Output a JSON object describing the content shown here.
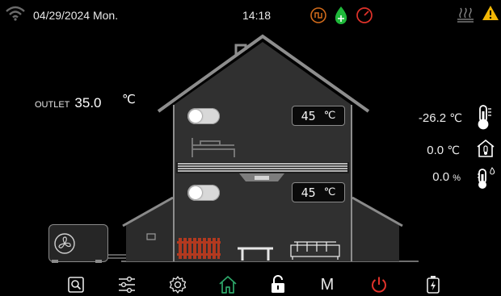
{
  "status_bar": {
    "wifi_icon": "wifi-icon",
    "datetime": "04/29/2024 Mon.",
    "time": "14:18",
    "center_icons": [
      "pump-icon",
      "add-drop-icon",
      "gauge-icon"
    ],
    "right_icons": [
      "floor-heating-icon",
      "warning-icon"
    ]
  },
  "colors": {
    "background": "#000000",
    "house_fill": "#2f2f2f",
    "accent_orange": "#d06a1a",
    "accent_green": "#1fb83a",
    "accent_red": "#e0322a",
    "warning_yellow": "#f2b705",
    "home_active": "#2ea86a",
    "power_red": "#e0322a"
  },
  "outlet": {
    "label": "OUTLET",
    "value": "35.0",
    "unit": "℃"
  },
  "zones": [
    {
      "name": "upper",
      "setpoint": "45",
      "unit": "℃",
      "toggle_on": false
    },
    {
      "name": "lower",
      "setpoint": "45",
      "unit": "℃",
      "toggle_on": false
    }
  ],
  "readings": [
    {
      "value": "-26.2",
      "unit": "℃",
      "icon": "outdoor-thermometer-icon"
    },
    {
      "value": "0.0",
      "unit": "℃",
      "icon": "indoor-house-temp-icon"
    },
    {
      "value": "0.0",
      "unit": "%",
      "icon": "humidity-thermometer-icon"
    }
  ],
  "nav": [
    {
      "name": "search-button",
      "icon": "magnifier-icon"
    },
    {
      "name": "settings-sliders-button",
      "icon": "sliders-icon"
    },
    {
      "name": "gear-button",
      "icon": "gear-icon"
    },
    {
      "name": "home-button",
      "icon": "home-icon"
    },
    {
      "name": "lock-button",
      "icon": "unlock-icon"
    },
    {
      "name": "mode-button",
      "label": "M"
    },
    {
      "name": "power-button",
      "icon": "power-icon"
    },
    {
      "name": "battery-button",
      "icon": "battery-charge-icon"
    }
  ]
}
